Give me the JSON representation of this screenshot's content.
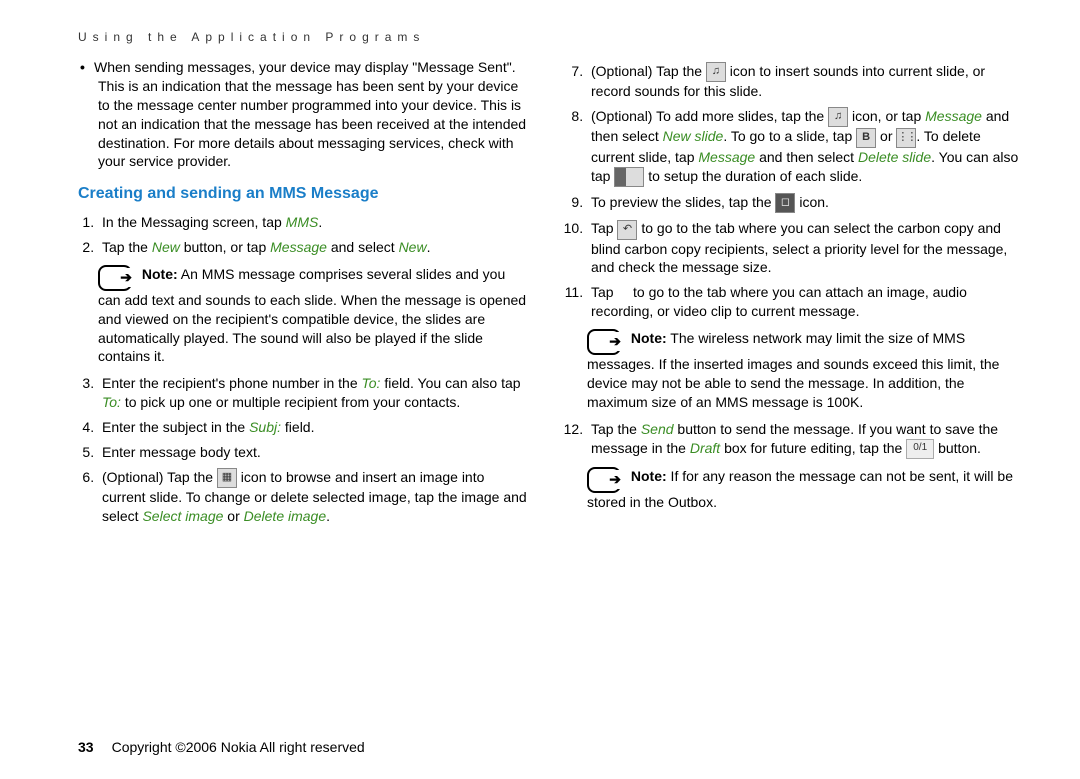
{
  "section_header": "Using the Application Programs",
  "bullet_intro": "When sending messages, your device may display \"Message Sent\". This is an indication that the message has been sent by your device to the message center number programmed into your device. This is not an indication that the message has been received at the intended destination. For more details about messaging services, check with your service provider.",
  "heading": "Creating and sending an MMS Message",
  "left": {
    "s1a": "In the Messaging screen, tap ",
    "s1b": "MMS",
    "s1c": ".",
    "s2a": "Tap the ",
    "s2b": "New",
    "s2c": " button, or tap ",
    "s2d": "Message",
    "s2e": " and select ",
    "s2f": "New",
    "s2g": ".",
    "note1_label": "Note:",
    "note1": " An MMS message comprises several slides and you can add text and sounds to each slide. When the message is opened and viewed on the recipient's compatible device, the slides are automatically played. The sound will also be played if the slide contains it.",
    "s3a": "Enter the recipient's phone number in the ",
    "s3b": "To:",
    "s3c": " field. You can also tap ",
    "s3d": "To:",
    "s3e": " to pick up one or multiple recipient from your contacts.",
    "s4a": "Enter the subject in the ",
    "s4b": "Subj:",
    "s4c": " field.",
    "s5": "Enter message body text.",
    "s6a": "(Optional) Tap the ",
    "s6b": " icon to browse and insert an image into current slide. To change or delete selected image, tap the image and select ",
    "s6c": "Select image",
    "s6d": " or ",
    "s6e": "Delete image",
    "s6f": "."
  },
  "right": {
    "s7a": "(Optional) Tap the ",
    "s7b": " icon to insert sounds into current slide, or record sounds for this slide.",
    "s8a": "(Optional) To add more slides, tap the ",
    "s8b": " icon, or tap ",
    "s8c": "Message",
    "s8d": " and then select ",
    "s8e": "New slide",
    "s8f": ". To go to a slide, tap ",
    "s8g": " or ",
    "s8h": ". To delete current slide, tap ",
    "s8i": "Message",
    "s8j": " and then select ",
    "s8k": "Delete slide",
    "s8l": ". You can also tap ",
    "s8m": " to setup the duration of each slide.",
    "s9a": "To preview the slides, tap the ",
    "s9b": " icon.",
    "s10a": "Tap ",
    "s10b": " to go to the tab where you can select the carbon copy and blind carbon copy recipients, select a priority level for the message, and check the message size.",
    "s11a": "Tap ",
    "s11b": " to go to the tab where you can attach an image, audio recording, or video clip to current message.",
    "note2_label": "Note:",
    "note2": " The wireless network may limit the size of MMS messages. If the inserted images and sounds exceed this limit, the device may not be able to send the message. In addition, the maximum size of an MMS message is 100K.",
    "s12a": "Tap the ",
    "s12b": "Send",
    "s12c": " button to send the message. If you want to save the message in the ",
    "s12d": "Draft",
    "s12e": " box for future editing, tap the ",
    "s12f": " button.",
    "icon01_label": "0/1",
    "note3_label": "Note:",
    "note3": " If for any reason the message can not be sent, it will be stored in the Outbox."
  },
  "footer": {
    "page": "33",
    "copyright": "Copyright ©2006 Nokia All right reserved"
  }
}
